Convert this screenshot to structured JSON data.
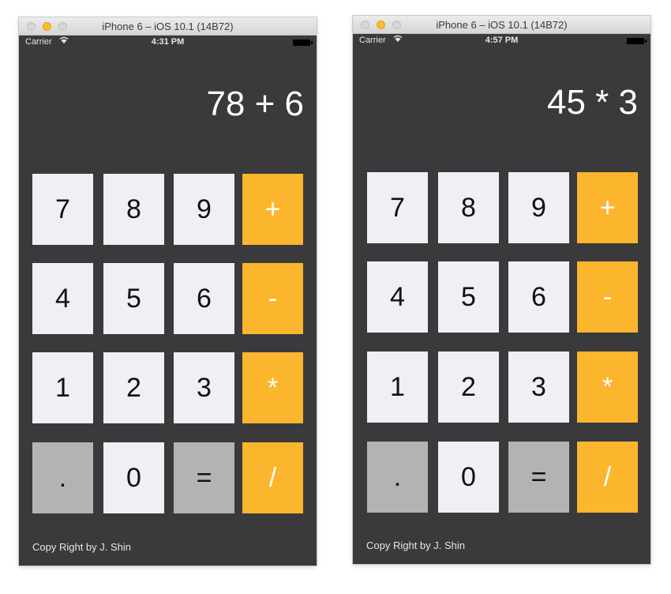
{
  "colors": {
    "background": "#3a3a3c",
    "number_key": "#efeff4",
    "function_key": "#b3b3b3",
    "operator_key": "#fcb62e",
    "display_text": "#ffffff",
    "traffic_light_minimize": "#fdbc2e"
  },
  "simulators": [
    {
      "window_title": "iPhone 6 – iOS 10.1 (14B72)",
      "status": {
        "carrier": "Carrier",
        "wifi_icon": "wifi-icon",
        "time": "4:31 PM",
        "battery_icon": "battery-icon"
      },
      "display": "78 + 6",
      "footer": "Copy Right by J. Shin"
    },
    {
      "window_title": "iPhone 6 – iOS 10.1 (14B72)",
      "status": {
        "carrier": "Carrier",
        "wifi_icon": "wifi-icon",
        "time": "4:57 PM",
        "battery_icon": "battery-icon"
      },
      "display": "45 * 3",
      "footer": "Copy Right by J. Shin"
    }
  ],
  "keypad": [
    [
      {
        "label": "7",
        "style": "num"
      },
      {
        "label": "8",
        "style": "num"
      },
      {
        "label": "9",
        "style": "num"
      },
      {
        "label": "+",
        "style": "op"
      }
    ],
    [
      {
        "label": "4",
        "style": "num"
      },
      {
        "label": "5",
        "style": "num"
      },
      {
        "label": "6",
        "style": "num"
      },
      {
        "label": "-",
        "style": "op"
      }
    ],
    [
      {
        "label": "1",
        "style": "num"
      },
      {
        "label": "2",
        "style": "num"
      },
      {
        "label": "3",
        "style": "num"
      },
      {
        "label": "*",
        "style": "op"
      }
    ],
    [
      {
        "label": ".",
        "style": "gray"
      },
      {
        "label": "0",
        "style": "num"
      },
      {
        "label": "=",
        "style": "gray"
      },
      {
        "label": "/",
        "style": "op"
      }
    ]
  ]
}
